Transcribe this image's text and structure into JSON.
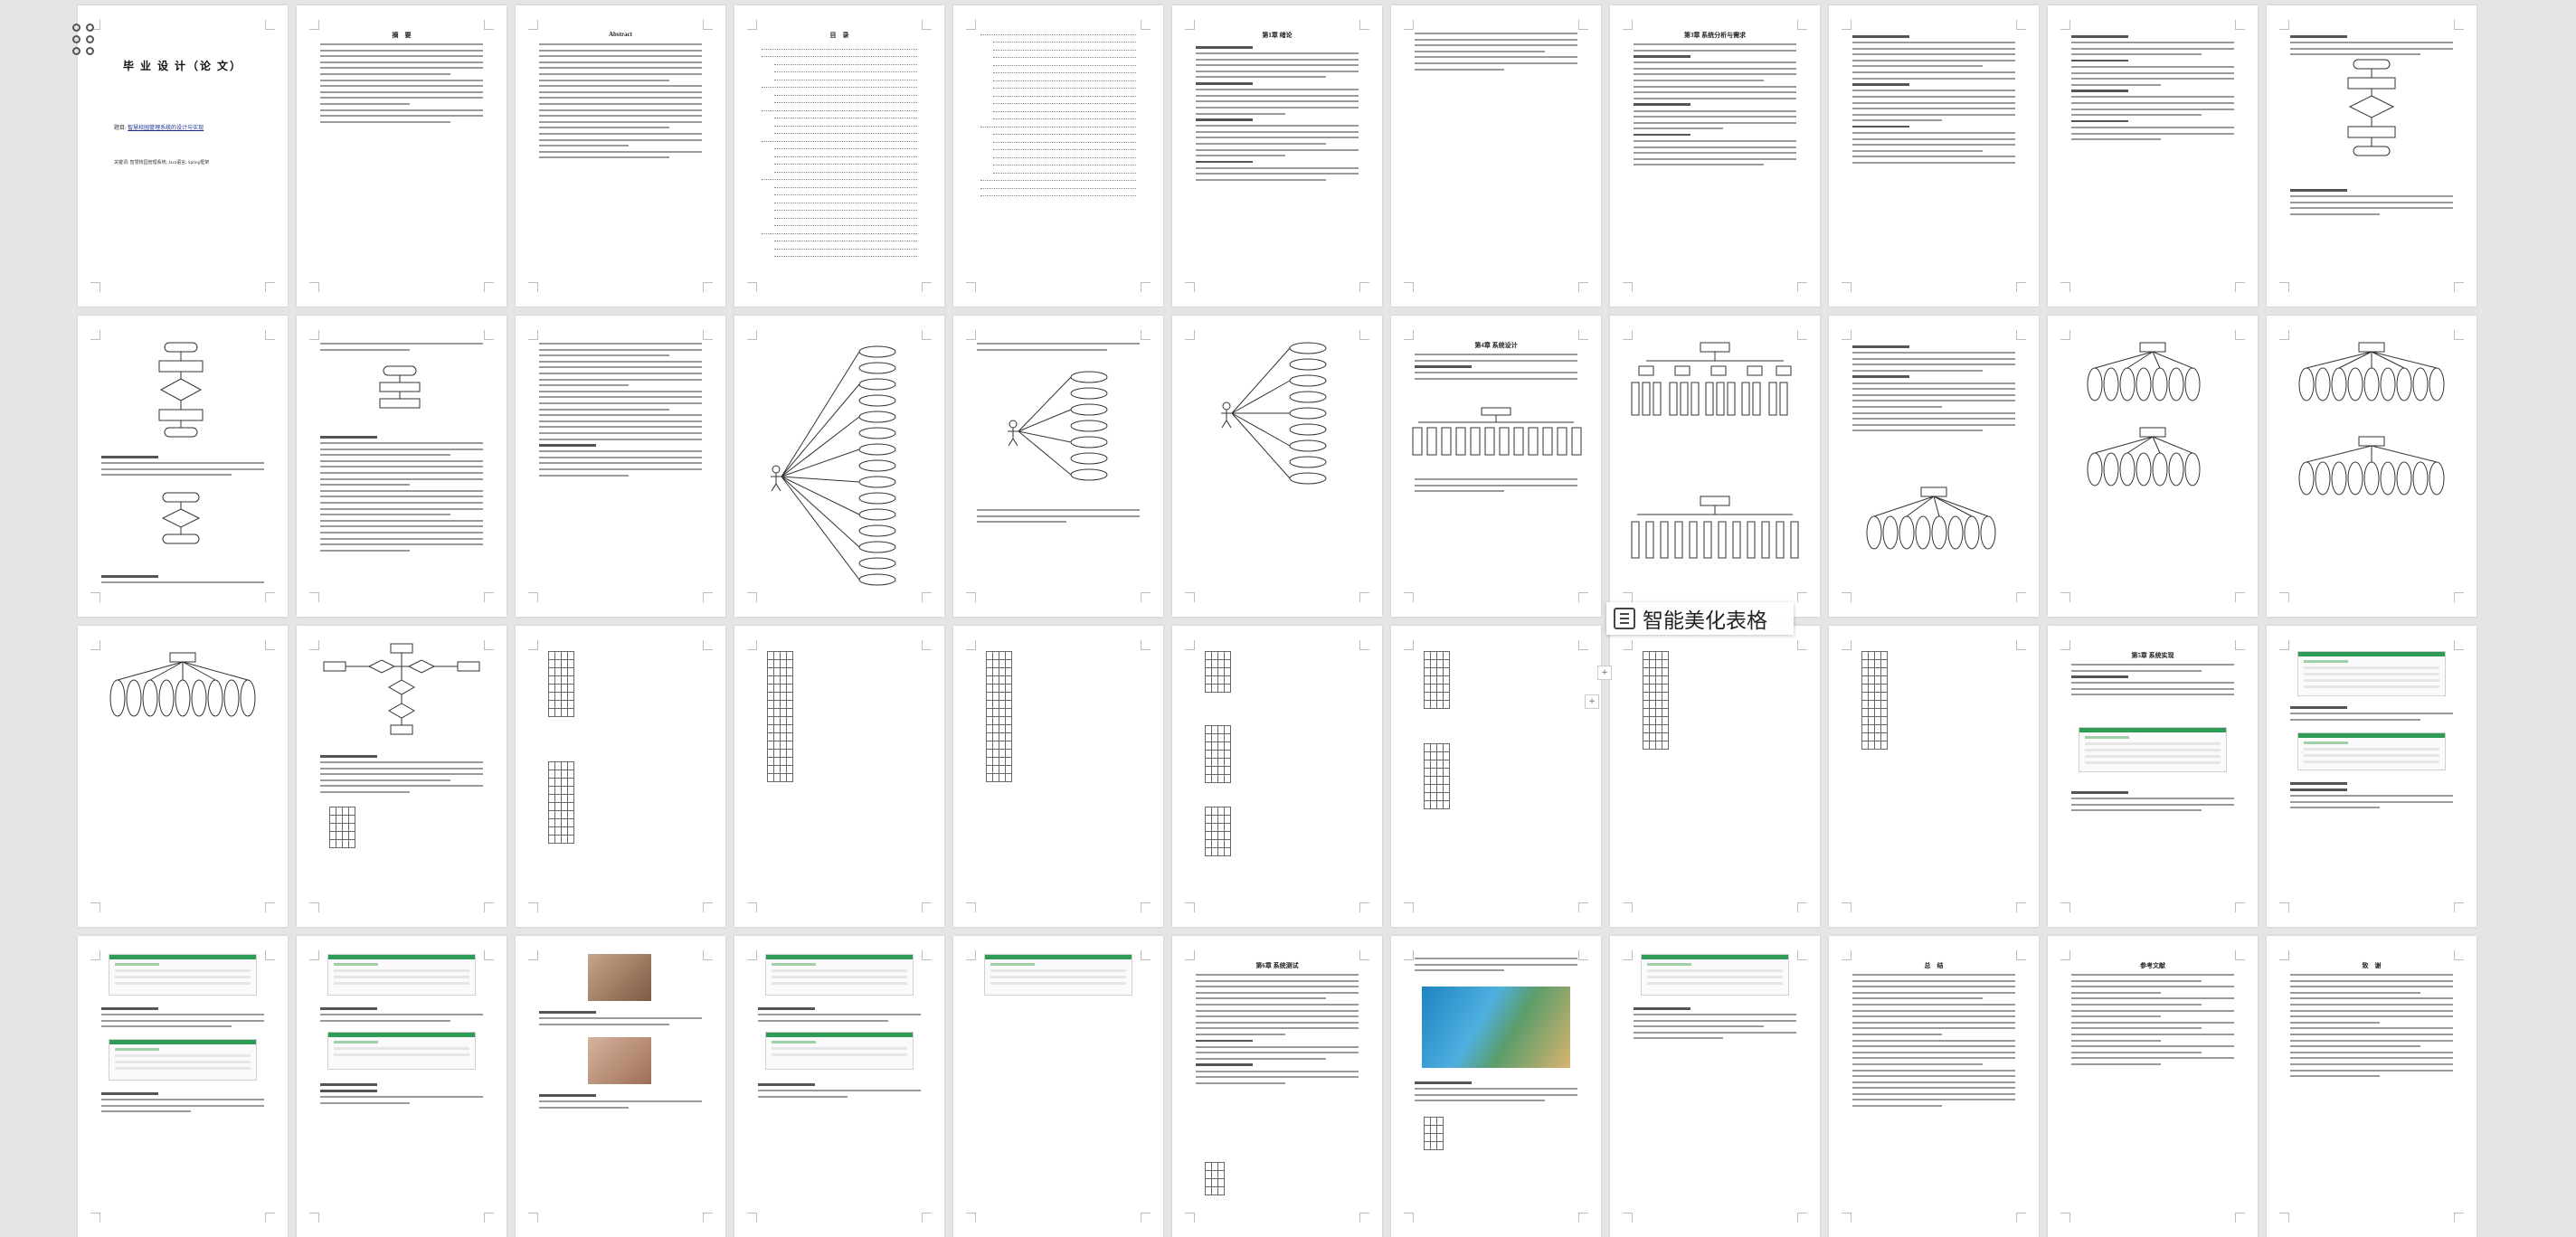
{
  "toolbar": {
    "grid_icon": "grid-view-icon"
  },
  "document": {
    "cover": {
      "title": "毕 业 设 计（论 文）",
      "topic_label": "题目:",
      "topic": "智慧校园管理系统的设计与实现",
      "keywords": "关键词: 智慧校园管理系统; Java语言; Spring框架"
    },
    "headings": {
      "abstract_cn": "摘　要",
      "abstract_en": "Abstract",
      "contents": "目　录",
      "chapter1": "第1章 绪论",
      "chapter3": "第3章 系统分析与需求",
      "chapter4": "第4章 系统设计",
      "chapter5": "第5章 系统实现",
      "chapter6": "第6章 系统测试",
      "conclusion": "总　结",
      "references": "参考文献",
      "thanks": "致　谢"
    }
  },
  "overlay": {
    "beautify_label": "智能美化表格",
    "beautify_icon": "table-magic-icon"
  },
  "colors": {
    "accent_green": "#2e9b57",
    "background": "#e5e5e5"
  }
}
